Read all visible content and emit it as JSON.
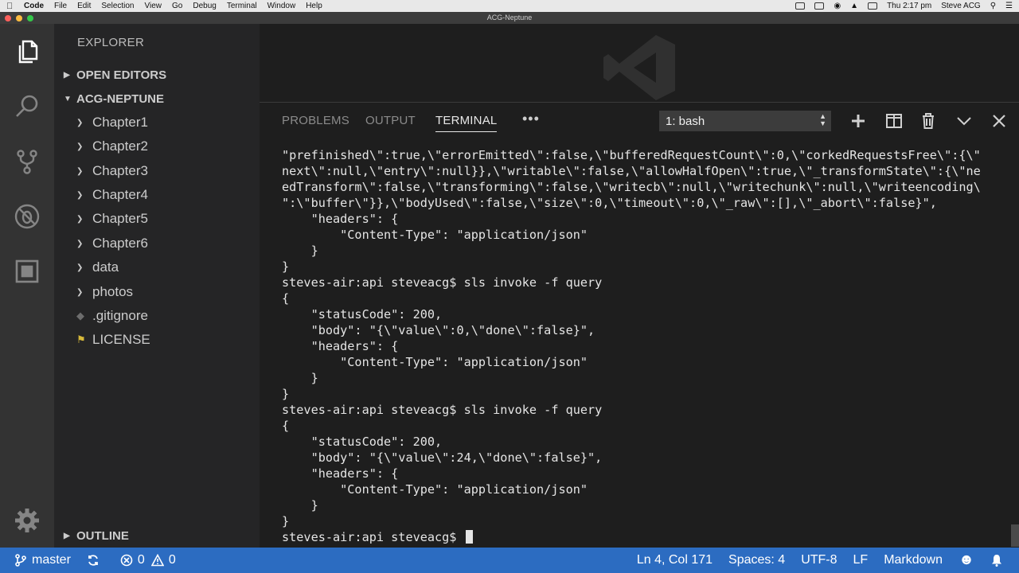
{
  "menubar": {
    "app": "Code",
    "items": [
      "File",
      "Edit",
      "Selection",
      "View",
      "Go",
      "Debug",
      "Terminal",
      "Window",
      "Help"
    ],
    "clock": "Thu 2:17 pm",
    "user": "Steve ACG"
  },
  "window": {
    "title": "ACG-Neptune"
  },
  "activity_bar": {
    "icons": [
      "explorer-icon",
      "search-icon",
      "source-control-icon",
      "debug-icon",
      "extensions-icon",
      "gear-icon"
    ]
  },
  "sidebar": {
    "title": "EXPLORER",
    "open_editors": "OPEN EDITORS",
    "project": "ACG-NEPTUNE",
    "items": [
      {
        "label": "Chapter1",
        "type": "folder"
      },
      {
        "label": "Chapter2",
        "type": "folder"
      },
      {
        "label": "Chapter3",
        "type": "folder"
      },
      {
        "label": "Chapter4",
        "type": "folder"
      },
      {
        "label": "Chapter5",
        "type": "folder"
      },
      {
        "label": "Chapter6",
        "type": "folder"
      },
      {
        "label": "data",
        "type": "folder"
      },
      {
        "label": "photos",
        "type": "folder"
      },
      {
        "label": ".gitignore",
        "type": "file"
      },
      {
        "label": "LICENSE",
        "type": "file"
      }
    ],
    "outline": "OUTLINE"
  },
  "panel": {
    "tabs": [
      "PROBLEMS",
      "OUTPUT",
      "TERMINAL"
    ],
    "active_tab": "TERMINAL",
    "terminal_select": "1: bash",
    "lines": [
      "\"prefinished\\\":true,\\\"errorEmitted\\\":false,\\\"bufferedRequestCount\\\":0,\\\"corkedRequestsFree\\\":{\\\"",
      "next\\\":null,\\\"entry\\\":null}},\\\"writable\\\":false,\\\"allowHalfOpen\\\":true,\\\"_transformState\\\":{\\\"ne",
      "edTransform\\\":false,\\\"transforming\\\":false,\\\"writecb\\\":null,\\\"writechunk\\\":null,\\\"writeencoding\\",
      "\":\\\"buffer\\\"}},\\\"bodyUsed\\\":false,\\\"size\\\":0,\\\"timeout\\\":0,\\\"_raw\\\":[],\\\"_abort\\\":false}\",",
      "    \"headers\": {",
      "        \"Content-Type\": \"application/json\"",
      "    }",
      "}",
      "steves-air:api steveacg$ sls invoke -f query",
      "{",
      "    \"statusCode\": 200,",
      "    \"body\": \"{\\\"value\\\":0,\\\"done\\\":false}\",",
      "    \"headers\": {",
      "        \"Content-Type\": \"application/json\"",
      "    }",
      "}",
      "steves-air:api steveacg$ sls invoke -f query",
      "{",
      "    \"statusCode\": 200,",
      "    \"body\": \"{\\\"value\\\":24,\\\"done\\\":false}\",",
      "    \"headers\": {",
      "        \"Content-Type\": \"application/json\"",
      "    }",
      "}"
    ],
    "prompt": "steves-air:api steveacg$ "
  },
  "statusbar": {
    "branch": "master",
    "errors": "0",
    "warnings": "0",
    "position": "Ln 4, Col 171",
    "spaces": "Spaces: 4",
    "encoding": "UTF-8",
    "eol": "LF",
    "language": "Markdown"
  },
  "colors": {
    "statusbar": "#2c6cc1",
    "sidebar": "#252526",
    "activitybar": "#333333",
    "editor": "#1e1e1e"
  }
}
